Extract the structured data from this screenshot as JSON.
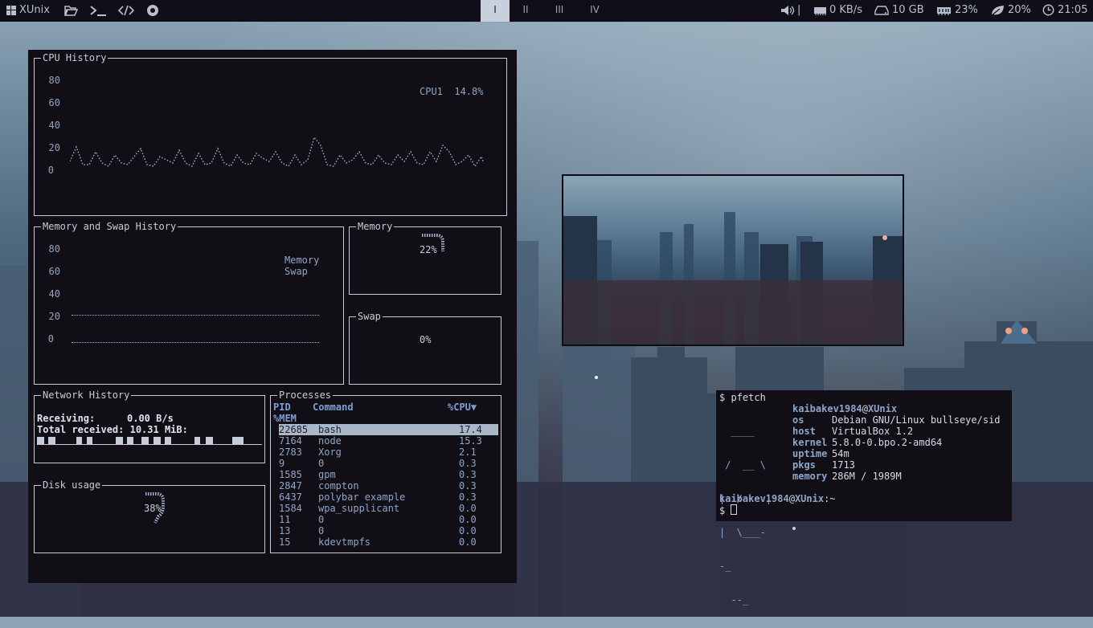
{
  "topbar": {
    "brand": "XUnix",
    "workspaces": [
      "I",
      "II",
      "III",
      "IV"
    ],
    "active_workspace": "I",
    "volume_sep": "|",
    "net": "0 KB/s",
    "disk": "10 GB",
    "ram": "23%",
    "cpu": "20%",
    "clock": "21:05"
  },
  "conky": {
    "cpu_title": "CPU History",
    "cpu_axis": [
      "80",
      "60",
      "40",
      "20",
      "0"
    ],
    "cpu_legend": "CPU1",
    "cpu_value": "14.8%",
    "memswap_title": "Memory and Swap History",
    "memswap_axis": [
      "80",
      "60",
      "40",
      "20",
      "0"
    ],
    "memswap_legend": [
      "Memory",
      "Swap"
    ],
    "memory_title": "Memory",
    "memory_value": "22%",
    "swap_title": "Swap",
    "swap_value": "0%",
    "network_title": "Network History",
    "receiving_label": "Receiving:",
    "receiving_value": "0.00 B/s",
    "total_label": "Total received:",
    "total_value": "10.31 MiB:",
    "disk_title": "Disk usage",
    "disk_value": "38%",
    "processes_title": "Processes",
    "proc_cols": {
      "pid": "PID",
      "command": "Command",
      "cpu": "%CPU▼",
      "mem": "%MEM"
    },
    "processes": [
      {
        "pid": "22685",
        "cmd": "bash",
        "cpu": "17.4"
      },
      {
        "pid": "7164",
        "cmd": "node",
        "cpu": "15.3"
      },
      {
        "pid": "2783",
        "cmd": "Xorg",
        "cpu": "2.1"
      },
      {
        "pid": "9",
        "cmd": "0",
        "cpu": "0.3"
      },
      {
        "pid": "1585",
        "cmd": "gpm",
        "cpu": "0.3"
      },
      {
        "pid": "2847",
        "cmd": "compton",
        "cpu": "0.3"
      },
      {
        "pid": "6437",
        "cmd": "polybar example",
        "cpu": "0.3"
      },
      {
        "pid": "1584",
        "cmd": "wpa_supplicant",
        "cpu": "0.0"
      },
      {
        "pid": "11",
        "cmd": "0",
        "cpu": "0.0"
      },
      {
        "pid": "13",
        "cmd": "0",
        "cpu": "0.0"
      },
      {
        "pid": "15",
        "cmd": "kdevtmpfs",
        "cpu": "0.0"
      }
    ]
  },
  "terminal": {
    "prompt": "$",
    "command": "pfetch",
    "user": "kaibakev1984",
    "at": "@",
    "host_name": "XUnix",
    "logo": [
      "  ____",
      " /  __ \\",
      "|  /    |",
      "|  \\___-",
      "-_",
      "  --_"
    ],
    "info": [
      {
        "key": "os",
        "val": "Debian GNU/Linux bullseye/sid"
      },
      {
        "key": "host",
        "val": "VirtualBox 1.2"
      },
      {
        "key": "kernel",
        "val": "5.8.0-0.bpo.2-amd64"
      },
      {
        "key": "uptime",
        "val": "54m"
      },
      {
        "key": "pkgs",
        "val": "1713"
      },
      {
        "key": "memory",
        "val": "286M / 1989M"
      }
    ],
    "prompt_line": ":~"
  },
  "colors": {
    "bar_bg": "#100f18",
    "panel_bg": "#110e16",
    "accent": "#8ea6c8",
    "active_ws": "#c7d0dc"
  }
}
